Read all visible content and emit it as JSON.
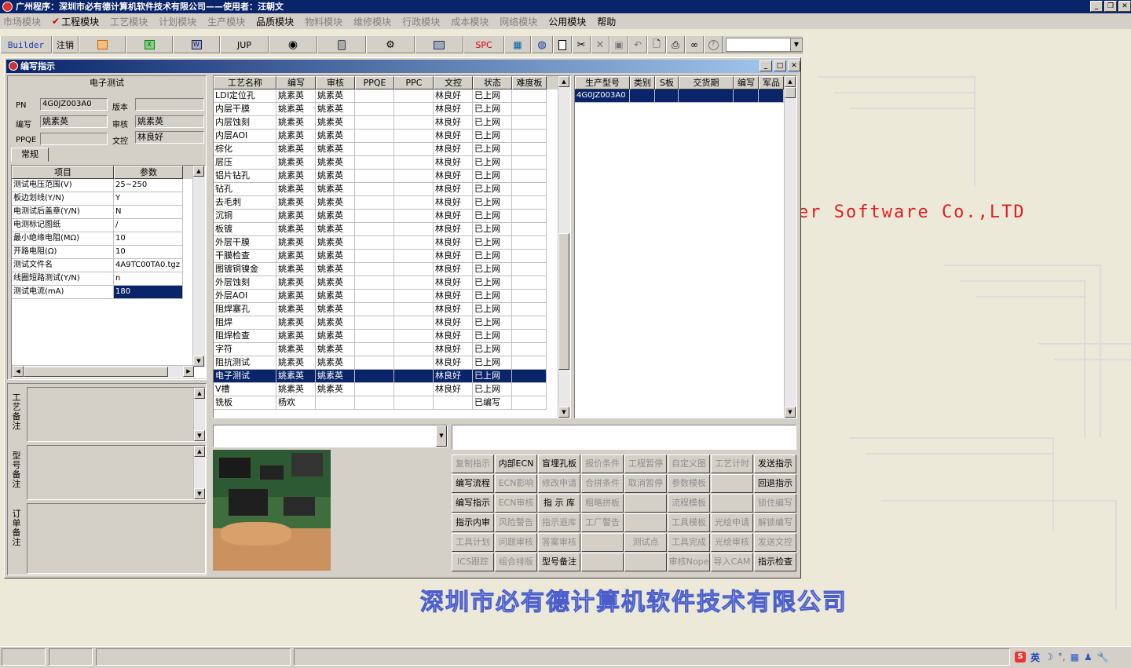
{
  "app_title": "广州程序：深圳市必有德计算机软件技术有限公司——使用者：汪朝文",
  "menu": [
    "市场模块",
    "工程模块",
    "工艺模块",
    "计划模块",
    "生产模块",
    "品质模块",
    "物料模块",
    "维修模块",
    "行政模块",
    "成本模块",
    "网络模块",
    "公用模块",
    "帮助"
  ],
  "toolbar": {
    "builder": "Builder",
    "logout": "注销",
    "jup": "JUP",
    "spc": "SPC"
  },
  "desktop": {
    "software_text": "er Software Co.,LTD",
    "company_text": "深圳市必有德计算机软件技术有限公司"
  },
  "window": {
    "title": "编写指示"
  },
  "left": {
    "section_title": "电子测试",
    "pn_label": "PN",
    "pn_value": "4G0JZ003A0",
    "version_label": "版本",
    "version_value": "",
    "author_label": "编写",
    "author_value": "姚素英",
    "review_label": "审核",
    "review_value": "姚素英",
    "ppqe_label": "PPQE",
    "ppqe_value": "",
    "doc_label": "文控",
    "doc_value": "林良好",
    "tab": "常规",
    "param_headers": [
      "项目",
      "参数"
    ],
    "params": [
      [
        "测试电压范围(V)",
        "25~250"
      ],
      [
        "板边划线(Y/N)",
        "Y"
      ],
      [
        "电测试后盖章(Y/N)",
        "N"
      ],
      [
        "电测标记图纸",
        "/"
      ],
      [
        "最小绝缘电阻(MΩ)",
        "10"
      ],
      [
        "开路电阻(Ω)",
        "10"
      ],
      [
        "测试文件名",
        "4A9TC00TA0.tgz"
      ],
      [
        "线圈短路测试(Y/N)",
        "n"
      ],
      [
        "测试电流(mA)",
        "180"
      ]
    ],
    "note_labels": [
      "工艺备注",
      "型号备注",
      "订单备注"
    ]
  },
  "process_table": {
    "headers": [
      "工艺名称",
      "编写",
      "审核",
      "PPQE",
      "PPC",
      "文控",
      "状态",
      "难度板"
    ],
    "rows": [
      [
        "LDI定位孔",
        "姚素英",
        "姚素英",
        "",
        "",
        "林良好",
        "已上网",
        ""
      ],
      [
        "内层干膜",
        "姚素英",
        "姚素英",
        "",
        "",
        "林良好",
        "已上网",
        ""
      ],
      [
        "内层蚀刻",
        "姚素英",
        "姚素英",
        "",
        "",
        "林良好",
        "已上网",
        ""
      ],
      [
        "内层AOI",
        "姚素英",
        "姚素英",
        "",
        "",
        "林良好",
        "已上网",
        ""
      ],
      [
        "棕化",
        "姚素英",
        "姚素英",
        "",
        "",
        "林良好",
        "已上网",
        ""
      ],
      [
        "层压",
        "姚素英",
        "姚素英",
        "",
        "",
        "林良好",
        "已上网",
        ""
      ],
      [
        "铝片钻孔",
        "姚素英",
        "姚素英",
        "",
        "",
        "林良好",
        "已上网",
        ""
      ],
      [
        "钻孔",
        "姚素英",
        "姚素英",
        "",
        "",
        "林良好",
        "已上网",
        ""
      ],
      [
        "去毛刺",
        "姚素英",
        "姚素英",
        "",
        "",
        "林良好",
        "已上网",
        ""
      ],
      [
        "沉铜",
        "姚素英",
        "姚素英",
        "",
        "",
        "林良好",
        "已上网",
        ""
      ],
      [
        "板镀",
        "姚素英",
        "姚素英",
        "",
        "",
        "林良好",
        "已上网",
        ""
      ],
      [
        "外层干膜",
        "姚素英",
        "姚素英",
        "",
        "",
        "林良好",
        "已上网",
        ""
      ],
      [
        "干膜检查",
        "姚素英",
        "姚素英",
        "",
        "",
        "林良好",
        "已上网",
        ""
      ],
      [
        "图镀铜镍金",
        "姚素英",
        "姚素英",
        "",
        "",
        "林良好",
        "已上网",
        ""
      ],
      [
        "外层蚀刻",
        "姚素英",
        "姚素英",
        "",
        "",
        "林良好",
        "已上网",
        ""
      ],
      [
        "外层AOI",
        "姚素英",
        "姚素英",
        "",
        "",
        "林良好",
        "已上网",
        ""
      ],
      [
        "阻焊塞孔",
        "姚素英",
        "姚素英",
        "",
        "",
        "林良好",
        "已上网",
        ""
      ],
      [
        "阻焊",
        "姚素英",
        "姚素英",
        "",
        "",
        "林良好",
        "已上网",
        ""
      ],
      [
        "阻焊检查",
        "姚素英",
        "姚素英",
        "",
        "",
        "林良好",
        "已上网",
        ""
      ],
      [
        "字符",
        "姚素英",
        "姚素英",
        "",
        "",
        "林良好",
        "已上网",
        ""
      ],
      [
        "阻抗测试",
        "姚素英",
        "姚素英",
        "",
        "",
        "林良好",
        "已上网",
        ""
      ],
      [
        "电子测试",
        "姚素英",
        "姚素英",
        "",
        "",
        "林良好",
        "已上网",
        ""
      ],
      [
        "V槽",
        "姚素英",
        "姚素英",
        "",
        "",
        "林良好",
        "已上网",
        ""
      ],
      [
        "铣板",
        "杨欢",
        "",
        "",
        "",
        "",
        "已编写",
        ""
      ]
    ],
    "selected_row": 21
  },
  "model_table": {
    "headers": [
      "生产型号",
      "类别",
      "S板",
      "交货期",
      "编写",
      "军品"
    ],
    "rows": [
      [
        "4G0JZ003A0",
        "",
        "",
        "",
        "",
        ""
      ]
    ]
  },
  "buttons": [
    {
      "label": "复制指示",
      "enabled": false
    },
    {
      "label": "内部ECN",
      "enabled": true
    },
    {
      "label": "盲埋孔板",
      "enabled": true
    },
    {
      "label": "报价条件",
      "enabled": false
    },
    {
      "label": "工程暂停",
      "enabled": false
    },
    {
      "label": "自定义图",
      "enabled": false
    },
    {
      "label": "工艺计时",
      "enabled": false
    },
    {
      "label": "发送指示",
      "enabled": true
    },
    {
      "label": "编写流程",
      "enabled": true
    },
    {
      "label": "ECN影响",
      "enabled": false
    },
    {
      "label": "修改申请",
      "enabled": false
    },
    {
      "label": "合拼条件",
      "enabled": false
    },
    {
      "label": "取消暂停",
      "enabled": false
    },
    {
      "label": "参数模板",
      "enabled": false
    },
    {
      "label": "",
      "enabled": false
    },
    {
      "label": "回退指示",
      "enabled": true
    },
    {
      "label": "编写指示",
      "enabled": true
    },
    {
      "label": "ECN审核",
      "enabled": false
    },
    {
      "label": "指 示 库",
      "enabled": true
    },
    {
      "label": "粗略拼板",
      "enabled": false
    },
    {
      "label": "",
      "enabled": false
    },
    {
      "label": "流程模板",
      "enabled": false
    },
    {
      "label": "",
      "enabled": false
    },
    {
      "label": "锁住编写",
      "enabled": false
    },
    {
      "label": "指示内审",
      "enabled": true
    },
    {
      "label": "风险警告",
      "enabled": false
    },
    {
      "label": "指示退库",
      "enabled": false
    },
    {
      "label": "工厂警告",
      "enabled": false
    },
    {
      "label": "",
      "enabled": false
    },
    {
      "label": "工具模板",
      "enabled": false
    },
    {
      "label": "光绘申请",
      "enabled": false
    },
    {
      "label": "解锁编写",
      "enabled": false
    },
    {
      "label": "工具计划",
      "enabled": false
    },
    {
      "label": "问题审核",
      "enabled": false
    },
    {
      "label": "答案审核",
      "enabled": false
    },
    {
      "label": "",
      "enabled": false
    },
    {
      "label": "测试点",
      "enabled": false
    },
    {
      "label": "工具完成",
      "enabled": false
    },
    {
      "label": "光绘审核",
      "enabled": false
    },
    {
      "label": "发送文控",
      "enabled": false
    },
    {
      "label": "ICS跟踪",
      "enabled": false
    },
    {
      "label": "组合排版",
      "enabled": false
    },
    {
      "label": "型号备注",
      "enabled": true
    },
    {
      "label": "",
      "enabled": false
    },
    {
      "label": "",
      "enabled": false
    },
    {
      "label": "审核Nope",
      "enabled": false
    },
    {
      "label": "导入CAM",
      "enabled": false
    },
    {
      "label": "指示检查",
      "enabled": true
    }
  ],
  "tray": {
    "ime": "英"
  },
  "colors": {
    "title_bar": "#0a246a",
    "selection": "#0a246a",
    "desktop_red": "#e02020",
    "company_blue": "#4a5ecc"
  }
}
